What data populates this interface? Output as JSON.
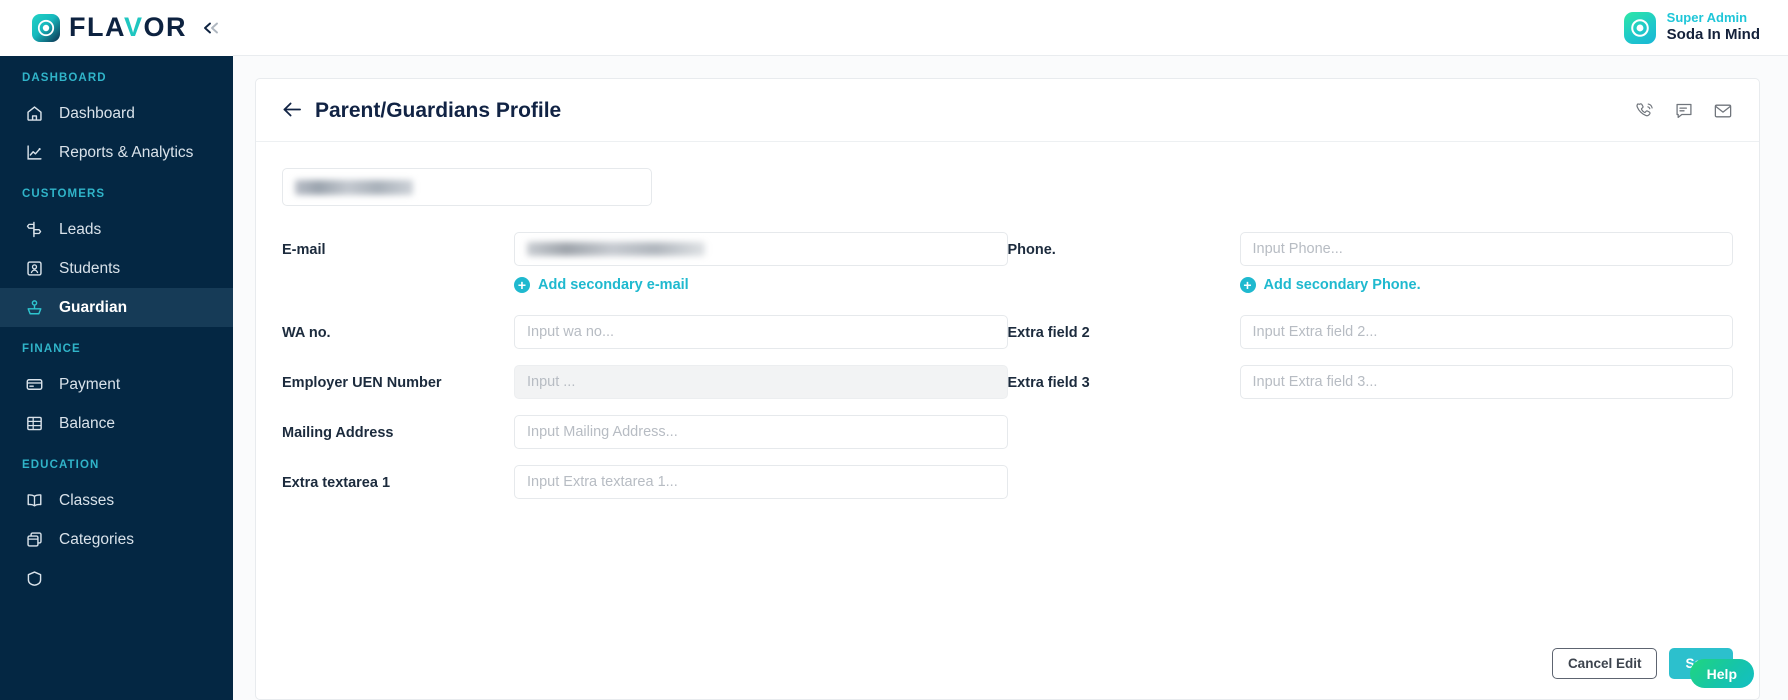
{
  "brand": {
    "name_part1": "FLA",
    "name_accent": "V",
    "name_part2": "OR",
    "logo_icon": "flavor-logo-mark",
    "collapse_icon": "double-chevron-left-icon"
  },
  "topbar": {
    "user_role": "Super Admin",
    "user_name": "Soda In Mind",
    "avatar_icon": "avatar-target-icon"
  },
  "sidebar": {
    "sections": [
      {
        "label": "DASHBOARD",
        "items": [
          {
            "label": "Dashboard",
            "icon": "home-icon",
            "active": false
          },
          {
            "label": "Reports & Analytics",
            "icon": "chart-line-icon",
            "active": false
          }
        ]
      },
      {
        "label": "CUSTOMERS",
        "items": [
          {
            "label": "Leads",
            "icon": "signpost-icon",
            "active": false
          },
          {
            "label": "Students",
            "icon": "id-card-icon",
            "active": false
          },
          {
            "label": "Guardian",
            "icon": "guardian-person-icon",
            "active": true
          }
        ]
      },
      {
        "label": "FINANCE",
        "items": [
          {
            "label": "Payment",
            "icon": "credit-card-icon",
            "active": false
          },
          {
            "label": "Balance",
            "icon": "ledger-icon",
            "active": false
          }
        ]
      },
      {
        "label": "EDUCATION",
        "items": [
          {
            "label": "Classes",
            "icon": "open-book-icon",
            "active": false
          },
          {
            "label": "Categories",
            "icon": "stacked-boxes-icon",
            "active": false
          }
        ]
      }
    ]
  },
  "page": {
    "title": "Parent/Guardians Profile",
    "back_icon": "arrow-left-icon",
    "header_actions": [
      {
        "name": "call-icon"
      },
      {
        "name": "chat-icon"
      },
      {
        "name": "mail-icon"
      }
    ]
  },
  "form": {
    "name_field": {
      "value": "",
      "redacted": true
    },
    "left_fields": [
      {
        "label": "E-mail",
        "placeholder": "",
        "value": "",
        "redacted": true,
        "disabled": false,
        "add_link": {
          "label": "Add secondary e-mail",
          "icon": "plus-circle-icon"
        }
      },
      {
        "label": "WA no.",
        "placeholder": "Input wa no...",
        "value": "",
        "redacted": false,
        "disabled": false
      },
      {
        "label": "Employer UEN Number",
        "placeholder": "Input ...",
        "value": "",
        "redacted": false,
        "disabled": true
      },
      {
        "label": "Mailing Address",
        "placeholder": "Input Mailing Address...",
        "value": "",
        "redacted": false,
        "disabled": false
      },
      {
        "label": "Extra textarea 1",
        "placeholder": "Input Extra textarea 1...",
        "value": "",
        "redacted": false,
        "disabled": false
      }
    ],
    "right_fields": [
      {
        "label": "Phone.",
        "placeholder": "Input  Phone...",
        "value": "",
        "redacted": false,
        "disabled": false,
        "add_link": {
          "label": "Add secondary Phone.",
          "icon": "plus-circle-icon"
        }
      },
      {
        "label": "Extra field 2",
        "placeholder": "Input Extra field 2...",
        "value": "",
        "redacted": false,
        "disabled": false
      },
      {
        "label": "Extra field 3",
        "placeholder": "Input Extra field 3...",
        "value": "",
        "redacted": false,
        "disabled": false
      }
    ]
  },
  "footer": {
    "cancel_label": "Cancel Edit",
    "save_label": "Save"
  },
  "help": {
    "label": "Help"
  },
  "colors": {
    "sidebar_bg": "#042743",
    "sidebar_active_bg": "#163b57",
    "accent_teal": "#1fb9cf",
    "primary_btn": "#2cc0cd",
    "section_label": "#30b4c9",
    "title_dark": "#112344"
  }
}
